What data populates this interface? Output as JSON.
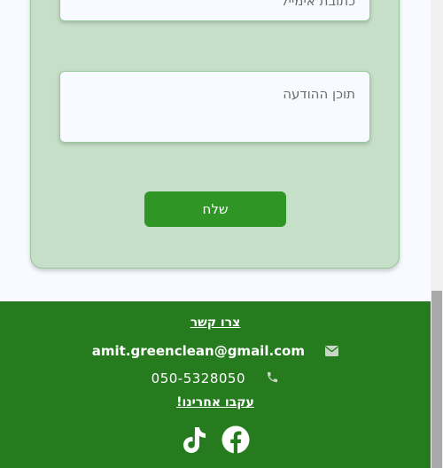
{
  "form": {
    "email_placeholder": "כתובת אימייל",
    "message_placeholder": "תוכן ההודעה",
    "send_label": "שלח"
  },
  "footer": {
    "contact_title": "צרו קשר",
    "email": "amit.greenclean@gmail.com",
    "phone": "050-5328050",
    "follow_title": "עקבו אחרינו!",
    "social_icons": [
      "tiktok-icon",
      "facebook-icon"
    ]
  },
  "colors": {
    "page_bg": "#f7fbff",
    "form_bg": "#c6dfc8",
    "button": "#2f9626",
    "footer_bg": "#257b1e"
  }
}
